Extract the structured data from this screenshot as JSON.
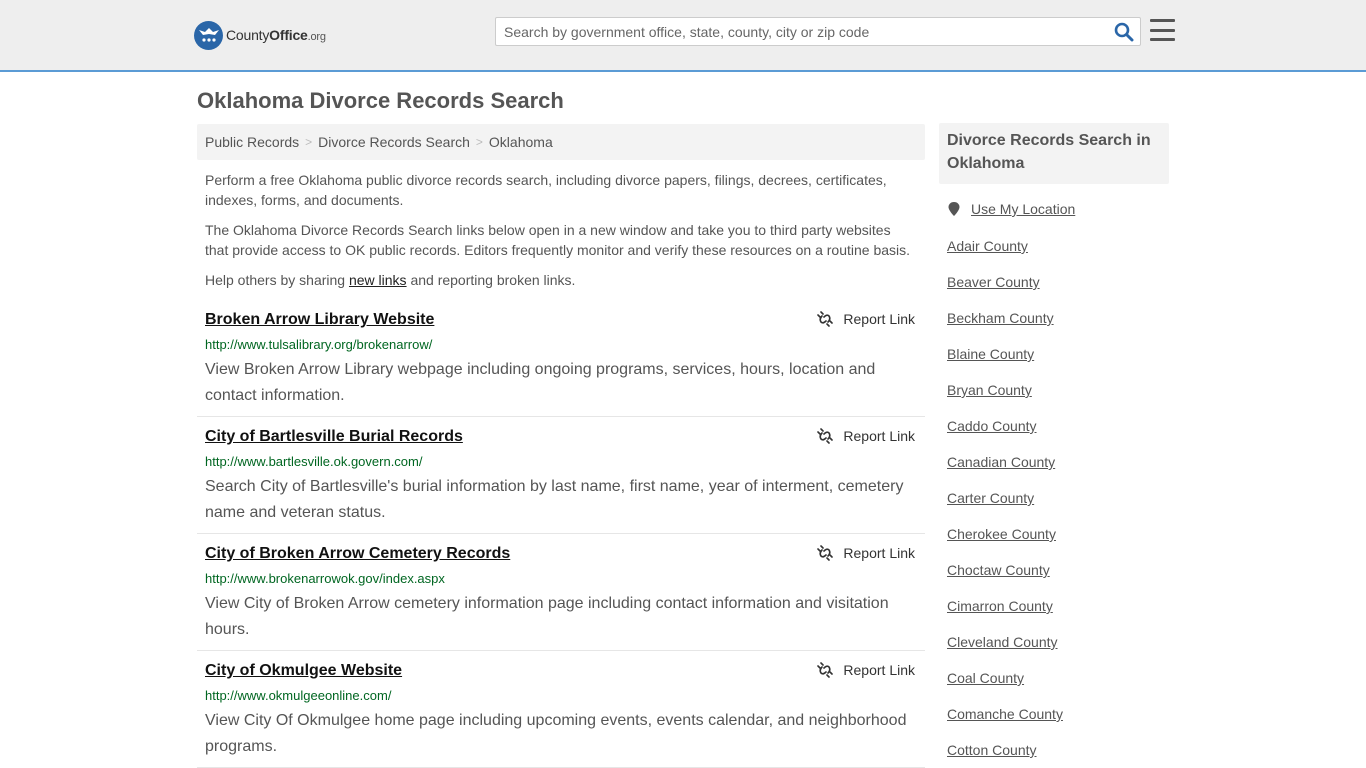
{
  "header": {
    "logo_county": "County",
    "logo_office": "Office",
    "logo_org": ".org",
    "search_placeholder": "Search by government office, state, county, city or zip code"
  },
  "page_title": "Oklahoma Divorce Records Search",
  "breadcrumb": [
    "Public Records",
    "Divorce Records Search",
    "Oklahoma"
  ],
  "intro": {
    "p1": "Perform a free Oklahoma public divorce records search, including divorce papers, filings, decrees, certificates, indexes, forms, and documents.",
    "p2": "The Oklahoma Divorce Records Search links below open in a new window and take you to third party websites that provide access to OK public records. Editors frequently monitor and verify these resources on a routine basis.",
    "p3_before": "Help others by sharing ",
    "p3_link": "new links",
    "p3_after": " and reporting broken links."
  },
  "report_label": "Report Link",
  "results": [
    {
      "title": "Broken Arrow Library Website",
      "url": "http://www.tulsalibrary.org/brokenarrow/",
      "desc": "View Broken Arrow Library webpage including ongoing programs, services, hours, location and contact information."
    },
    {
      "title": "City of Bartlesville Burial Records",
      "url": "http://www.bartlesville.ok.govern.com/",
      "desc": "Search City of Bartlesville's burial information by last name, first name, year of interment, cemetery name and veteran status."
    },
    {
      "title": "City of Broken Arrow Cemetery Records",
      "url": "http://www.brokenarrowok.gov/index.aspx",
      "desc": "View City of Broken Arrow cemetery information page including contact information and visitation hours."
    },
    {
      "title": "City of Okmulgee Website",
      "url": "http://www.okmulgeeonline.com/",
      "desc": "View City Of Okmulgee home page including upcoming events, events calendar, and neighborhood programs."
    }
  ],
  "sidebar": {
    "heading": "Divorce Records Search in Oklahoma",
    "use_location": "Use My Location",
    "counties": [
      "Adair County",
      "Beaver County",
      "Beckham County",
      "Blaine County",
      "Bryan County",
      "Caddo County",
      "Canadian County",
      "Carter County",
      "Cherokee County",
      "Choctaw County",
      "Cimarron County",
      "Cleveland County",
      "Coal County",
      "Comanche County",
      "Cotton County"
    ]
  },
  "colors": {
    "header_bg": "#eeeeee",
    "header_border": "#5b9bd5",
    "logo_blue": "#2a66a8",
    "search_icon": "#2a66a8",
    "url_green": "#006621"
  },
  "icons": {
    "search": "search-icon",
    "menu": "hamburger-menu-icon",
    "report": "broken-link-icon",
    "location": "map-pin-icon",
    "logo": "eagle-stars-logo-icon"
  }
}
